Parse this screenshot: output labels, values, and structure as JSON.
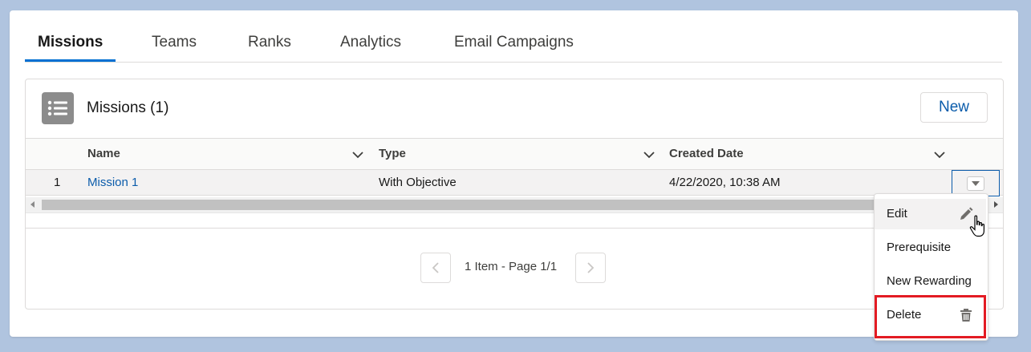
{
  "tabs": [
    {
      "label": "Missions",
      "active": true
    },
    {
      "label": "Teams",
      "active": false
    },
    {
      "label": "Ranks",
      "active": false
    },
    {
      "label": "Analytics",
      "active": false
    },
    {
      "label": "Email Campaigns",
      "active": false
    }
  ],
  "panel": {
    "title": "Missions (1)",
    "icon": "list-icon",
    "new_label": "New"
  },
  "table": {
    "columns": [
      "Name",
      "Type",
      "Created Date"
    ],
    "rows": [
      {
        "index": "1",
        "name": "Mission 1",
        "type": "With Objective",
        "created": "4/22/2020, 10:38 AM"
      }
    ]
  },
  "pagination": {
    "text": "1 Item - Page 1/1"
  },
  "menu": {
    "items": [
      {
        "label": "Edit",
        "icon": "pencil-icon"
      },
      {
        "label": "Prerequisite",
        "icon": ""
      },
      {
        "label": "New Rewarding",
        "icon": ""
      },
      {
        "label": "Delete",
        "icon": "trash-icon"
      }
    ]
  },
  "colors": {
    "accent": "#0070d2",
    "link": "#0b5cab",
    "highlight": "#e31b23",
    "background": "#b0c4df"
  }
}
